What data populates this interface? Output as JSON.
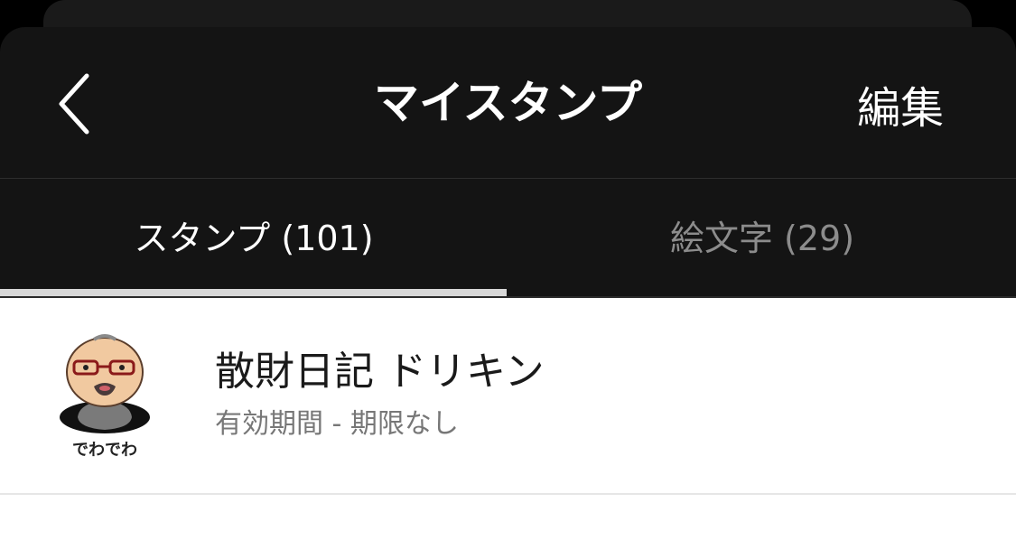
{
  "header": {
    "title": "マイスタンプ",
    "back_icon": "chevron-left-icon",
    "edit_label": "編集"
  },
  "tabs": [
    {
      "label": "スタンプ (101)",
      "active": true
    },
    {
      "label": "絵文字 (29)",
      "active": false
    }
  ],
  "stickers": [
    {
      "title": "散財日記 ドリキン",
      "subtitle": "有効期間 - 期限なし",
      "thumb_caption": "でわでわ"
    }
  ],
  "colors": {
    "background": "#141414",
    "active_tab_text": "#ffffff",
    "inactive_tab_text": "#8c8c8c",
    "indicator": "#d8d8d8",
    "list_background": "#ffffff"
  }
}
